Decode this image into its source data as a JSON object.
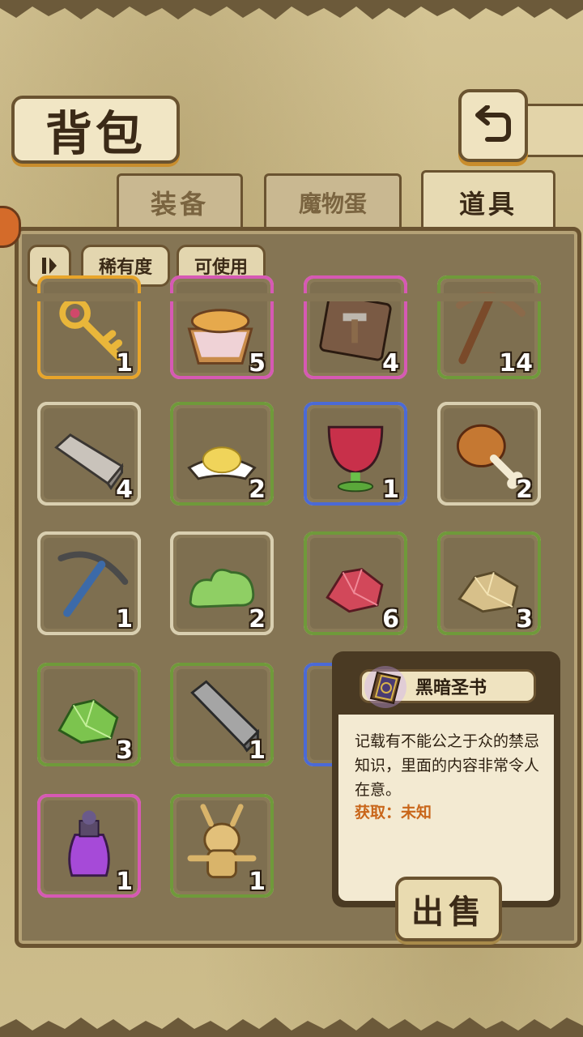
{
  "header": {
    "title": "背包",
    "back_icon": "return-arrow-icon"
  },
  "tabs": [
    {
      "label": "装备",
      "active": false
    },
    {
      "label": "魔物蛋",
      "active": false
    },
    {
      "label": "道具",
      "active": true
    }
  ],
  "filters": {
    "sort_icon": "pause-sort-icon",
    "rarity_label": "稀有度",
    "usable_label": "可使用"
  },
  "items": [
    {
      "icon": "golden-key-icon",
      "count": "1",
      "rarity": "#e8a52a"
    },
    {
      "icon": "bread-basket-icon",
      "count": "5",
      "rarity": "#d659b4"
    },
    {
      "icon": "hammer-card-icon",
      "count": "4",
      "rarity": "#d659b4"
    },
    {
      "icon": "pickaxe-wood-icon",
      "count": "14",
      "rarity": "#6f9a3a"
    },
    {
      "icon": "stone-bar-icon",
      "count": "4",
      "rarity": "#d9cfb0"
    },
    {
      "icon": "sand-pile-icon",
      "count": "2",
      "rarity": "#6f9a3a"
    },
    {
      "icon": "red-goblet-icon",
      "count": "1",
      "rarity": "#4b6ad6"
    },
    {
      "icon": "chicken-leg-icon",
      "count": "2",
      "rarity": "#d9cfb0"
    },
    {
      "icon": "iron-pickaxe-icon",
      "count": "1",
      "rarity": "#d9cfb0"
    },
    {
      "icon": "green-slime-icon",
      "count": "2",
      "rarity": "#d9cfb0"
    },
    {
      "icon": "red-crystal-icon",
      "count": "6",
      "rarity": "#6f9a3a"
    },
    {
      "icon": "gold-ore-icon",
      "count": "3",
      "rarity": "#6f9a3a"
    },
    {
      "icon": "green-crystal-icon",
      "count": "3",
      "rarity": "#6f9a3a"
    },
    {
      "icon": "iron-bar-icon",
      "count": "1",
      "rarity": "#6f9a3a"
    },
    {
      "icon": "hidden-slot",
      "count": "",
      "rarity": "#4b6ad6"
    },
    {
      "icon": "hidden-slot",
      "count": "",
      "rarity": "#4b6ad6"
    },
    {
      "icon": "purple-potion-icon",
      "count": "1",
      "rarity": "#d659b4"
    },
    {
      "icon": "voodoo-doll-icon",
      "count": "1",
      "rarity": "#6f9a3a"
    }
  ],
  "tooltip": {
    "icon": "dark-bible-icon",
    "name": "黑暗圣书",
    "description": "记载有不能公之于众的禁忌知识，里面的内容非常令人在意。",
    "source": "获取：未知"
  },
  "sell_button": {
    "label": "出售"
  }
}
